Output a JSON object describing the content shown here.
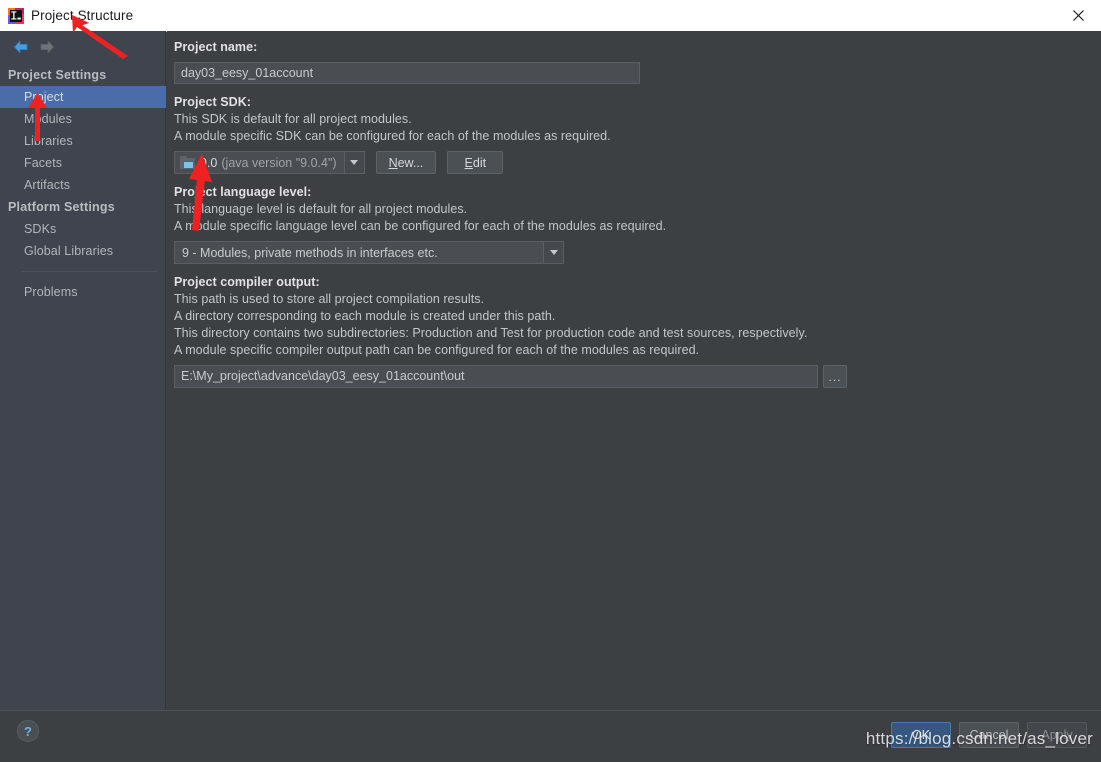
{
  "window": {
    "title": "Project Structure",
    "app_icon": "intellij-idea-icon",
    "close_label": "✕"
  },
  "sidebar": {
    "nav": {
      "back_icon": "arrow-back-icon",
      "forward_icon": "arrow-forward-icon"
    },
    "groups": [
      {
        "label": "Project Settings",
        "items": [
          {
            "label": "Project",
            "selected": true
          },
          {
            "label": "Modules",
            "selected": false
          },
          {
            "label": "Libraries",
            "selected": false
          },
          {
            "label": "Facets",
            "selected": false
          },
          {
            "label": "Artifacts",
            "selected": false
          }
        ]
      },
      {
        "label": "Platform Settings",
        "items": [
          {
            "label": "SDKs",
            "selected": false
          },
          {
            "label": "Global Libraries",
            "selected": false
          }
        ]
      }
    ],
    "problems": {
      "label": "Problems"
    }
  },
  "main": {
    "project_name": {
      "label": "Project name:",
      "value": "day03_eesy_01account",
      "placeholder": ""
    },
    "project_sdk": {
      "label": "Project SDK:",
      "description_lines": [
        "This SDK is default for all project modules.",
        "A module specific SDK can be configured for each of the modules as required."
      ],
      "selected_name": "9.0",
      "selected_detail": "(java version \"9.0.4\")",
      "icon": "jdk-folder-icon",
      "dropdown_icon": "chevron-down-icon",
      "new_button": "New...",
      "new_button_mnemonic": "N",
      "edit_button": "Edit",
      "edit_button_mnemonic": "E"
    },
    "language_level": {
      "label": "Project language level:",
      "description_lines": [
        "This language level is default for all project modules.",
        "A module specific language level can be configured for each of the modules as required."
      ],
      "selected": "9 - Modules, private methods in interfaces etc.",
      "dropdown_icon": "chevron-down-icon"
    },
    "compiler_output": {
      "label": "Project compiler output:",
      "description_lines": [
        "This path is used to store all project compilation results.",
        "A directory corresponding to each module is created under this path.",
        "This directory contains two subdirectories: Production and Test for production code and test sources, respectively.",
        "A module specific compiler output path can be configured for each of the modules as required."
      ],
      "value": "E:\\My_project\\advance\\day03_eesy_01account\\out",
      "browse_button": "...",
      "browse_icon": "ellipsis-browse-icon"
    }
  },
  "footer": {
    "help_label": "?",
    "help_icon": "help-question-icon",
    "buttons": [
      {
        "label": "OK",
        "style": "primary"
      },
      {
        "label": "Cancel",
        "style": "normal"
      },
      {
        "label": "Apply",
        "style": "disabled"
      }
    ]
  },
  "watermark": {
    "text": "https://blog.csdn.net/as_lover"
  },
  "annotations": {
    "arrow_color": "#ee2222",
    "arrows": [
      {
        "name": "arrow-to-title"
      },
      {
        "name": "arrow-to-project-item"
      },
      {
        "name": "arrow-to-sdk-combo"
      }
    ]
  },
  "colors": {
    "titlebar_bg": "#ffffff",
    "sidebar_bg": "#3f444e",
    "main_bg": "#3c4043",
    "selection_blue": "#4a6ca8",
    "primary_button": "#365880",
    "accent_link": "#6cb6e0"
  }
}
